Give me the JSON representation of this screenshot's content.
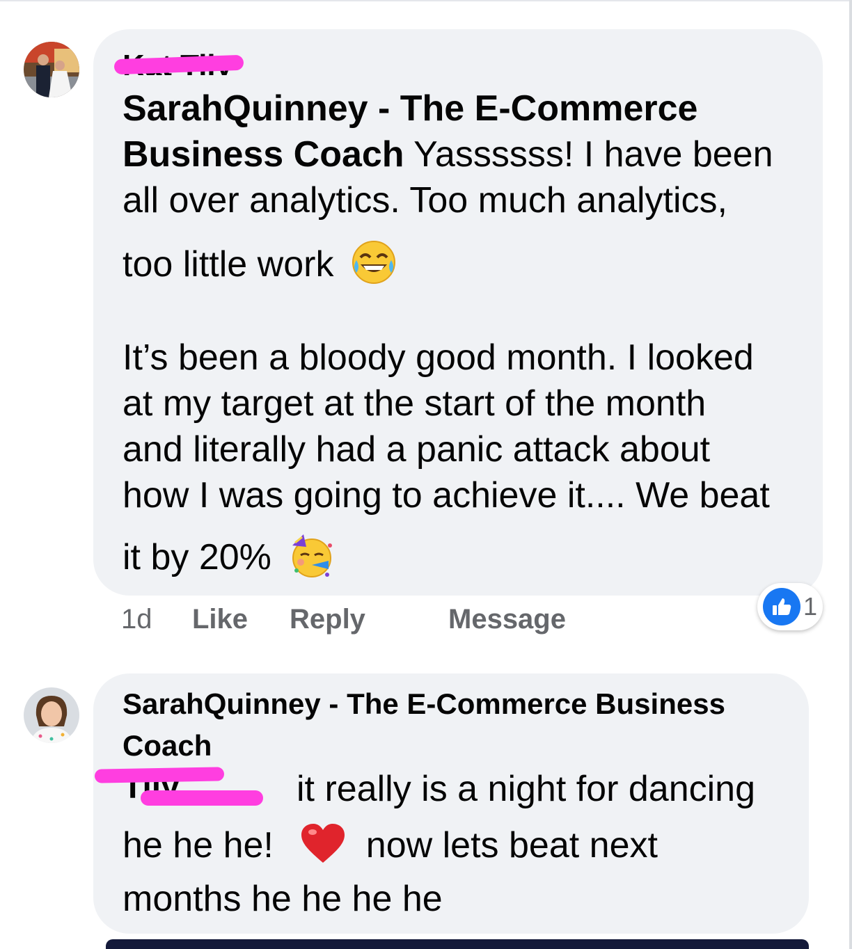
{
  "comment1": {
    "tagged_name": "Kat Tily",
    "author": "SarahQuinney - The E-Commerce Business Coach",
    "line1_name": "SarahQuinney - The E-Commerce",
    "line2_name": "Business Coach",
    "line2_text": "Yassssss! I have been",
    "line3": "all over analytics. Too much analytics,",
    "line4": "too little work",
    "line4_emoji": "face-with-tears-of-joy",
    "line5": "It’s been a bloody good month. I looked",
    "line6": "at my target at the start of the month",
    "line7": "and literally had a panic attack about",
    "line8": "how I was going to achieve it.... We beat",
    "line9": "it by 20%",
    "line9_emoji": "partying-face",
    "time": "1d",
    "like": "Like",
    "reply": "Reply",
    "message": "Message",
    "reaction_count": "1"
  },
  "comment2": {
    "author_line1": "SarahQuinney - The E-Commerce Business",
    "author_line2": "Coach",
    "tagged_name": "Tily",
    "line1": "it really is a night for dancing",
    "line2a": "he he he!",
    "line2_emoji": "red-heart",
    "line2b": "now lets beat next",
    "line3": "months  he he he he"
  },
  "colors": {
    "bubble": "#f0f2f5",
    "text": "#050505",
    "secondary": "#65676b",
    "like_blue": "#1877f2",
    "redaction": "#ff3ee0"
  }
}
